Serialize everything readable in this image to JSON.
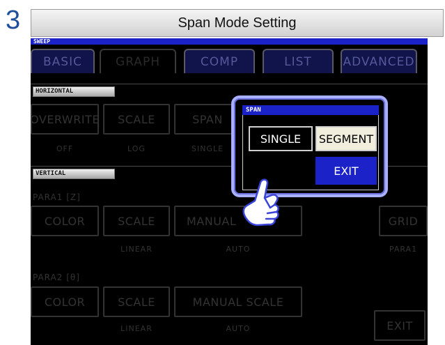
{
  "step_number": "3",
  "title": "Span Mode Setting",
  "screen": {
    "mode_label": "SWEEP",
    "tabs": [
      "BASIC",
      "GRAPH",
      "COMP",
      "LIST",
      "ADVANCED"
    ],
    "horizontal": {
      "section_label": "HORIZONTAL",
      "buttons": [
        {
          "label": "OVERWRITE",
          "value": "OFF"
        },
        {
          "label": "SCALE",
          "value": "LOG"
        },
        {
          "label": "SPAN",
          "value": "SINGLE"
        }
      ]
    },
    "vertical": {
      "section_label": "VERTICAL",
      "para1": {
        "label": "PARA1 [Z]",
        "color_label": "COLOR",
        "scale_label": "SCALE",
        "scale_value": "LINEAR",
        "manual_label": "MANUAL",
        "manual_value": "AUTO",
        "grid_label": "GRID",
        "grid_value": "PARA1"
      },
      "para2": {
        "label": "PARA2 [θ]",
        "color_label": "COLOR",
        "scale_label": "SCALE",
        "scale_value": "LINEAR",
        "manual_label": "MANUAL SCALE",
        "manual_value": "AUTO"
      }
    },
    "exit_label": "EXIT"
  },
  "dialog": {
    "title": "SPAN",
    "single_label": "SINGLE",
    "segment_label": "SEGMENT",
    "exit_label": "EXIT",
    "selected": "SEGMENT"
  },
  "icons": {
    "pointer": "hand-pointer-icon"
  },
  "colors": {
    "accent_blue": "#1a22c8",
    "dialog_border": "#a9b0ff",
    "selected_button": "#f1eedd"
  }
}
